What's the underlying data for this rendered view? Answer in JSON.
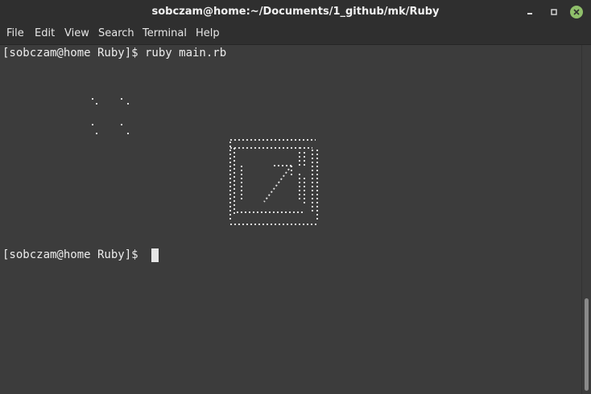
{
  "window": {
    "title": "sobczam@home:~/Documents/1_github/mk/Ruby",
    "close_color": "#8fbf6a"
  },
  "menu": {
    "items": [
      "File",
      "Edit",
      "View",
      "Search",
      "Terminal",
      "Help"
    ]
  },
  "terminal": {
    "line1": "[sobczam@home Ruby]$ ruby main.rb",
    "line2": "[sobczam@home Ruby]$ "
  }
}
